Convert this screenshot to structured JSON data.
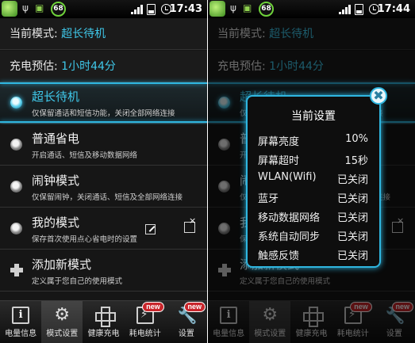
{
  "status_left": {
    "time": "17:43",
    "badge": "68"
  },
  "status_right": {
    "time": "17:44",
    "badge": "68"
  },
  "header": {
    "mode_label": "当前模式: ",
    "mode_value": "超长待机",
    "charge_label": "充电预估: ",
    "charge_value": "1小时44分"
  },
  "modes": [
    {
      "title": "超长待机",
      "desc": "仅保留通话和短信功能，关闭全部网络连接",
      "active": true
    },
    {
      "title": "普通省电",
      "desc": "开启通话、短信及移动数据网络",
      "active": false
    },
    {
      "title": "闹钟模式",
      "desc": "仅保留闹钟，关闭通话、短信及全部网络连接",
      "active": false
    },
    {
      "title": "我的模式",
      "desc": "保存首次使用点心省电时的设置",
      "active": false
    },
    {
      "title": "添加新模式",
      "desc": "定义属于您自己的使用模式",
      "active": false
    }
  ],
  "tabs": [
    {
      "label": "电量信息",
      "icon": "battery-info-icon"
    },
    {
      "label": "模式设置",
      "icon": "gear-icon"
    },
    {
      "label": "健康充电",
      "icon": "cross-icon"
    },
    {
      "label": "耗电统计",
      "icon": "bolt-icon",
      "badge": "new"
    },
    {
      "label": "设置",
      "icon": "wrench-icon",
      "badge": "new"
    }
  ],
  "dialog": {
    "title": "当前设置",
    "close_glyph": "✖",
    "rows": [
      {
        "key": "屏幕亮度",
        "value": "10%"
      },
      {
        "key": "屏幕超时",
        "value": "15秒"
      },
      {
        "key": "WLAN(Wifi)",
        "value": "已关闭"
      },
      {
        "key": "蓝牙",
        "value": "已关闭"
      },
      {
        "key": "移动数据网络",
        "value": "已关闭"
      },
      {
        "key": "系统自动同步",
        "value": "已关闭"
      },
      {
        "key": "触感反馈",
        "value": "已关闭"
      }
    ]
  },
  "colors": {
    "accent": "#2fb6e0",
    "value_text": "#3fc8ea",
    "badge_red": "#c9262c"
  }
}
